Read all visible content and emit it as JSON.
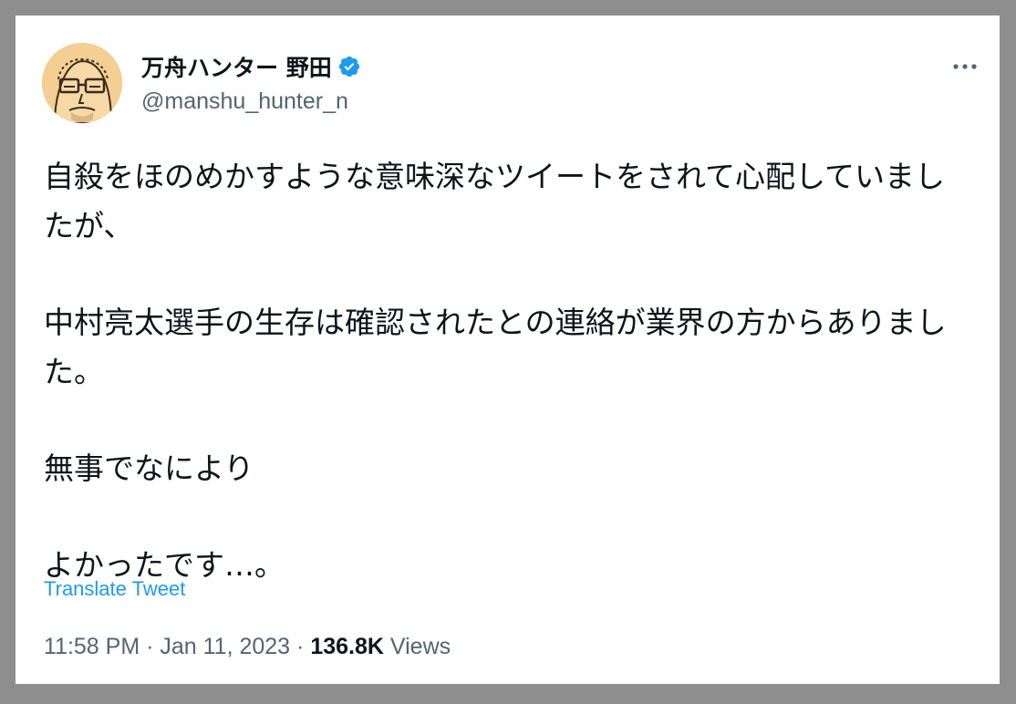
{
  "author": {
    "display_name": "万舟ハンター 野田",
    "handle": "@manshu_hunter_n",
    "verified": true,
    "avatar_icon": "avatar-cartoon-face"
  },
  "more_icon": "more-options-icon",
  "tweet": {
    "paragraphs": [
      "自殺をほのめかすような意味深なツイートをされて心配していましたが、",
      "中村亮太選手の生存は確認されたとの連絡が業界の方からありました。",
      "無事でなにより",
      "よかったです…。"
    ]
  },
  "translate_label": "Translate Tweet",
  "meta": {
    "time": "11:58 PM",
    "separator": " · ",
    "date": "Jan 11, 2023",
    "views_count": "136.8K",
    "views_label": "Views"
  },
  "colors": {
    "background": "#8e8e8e",
    "card": "#ffffff",
    "text": "#0f1419",
    "secondary": "#536471",
    "accent": "#1d9bf0"
  }
}
